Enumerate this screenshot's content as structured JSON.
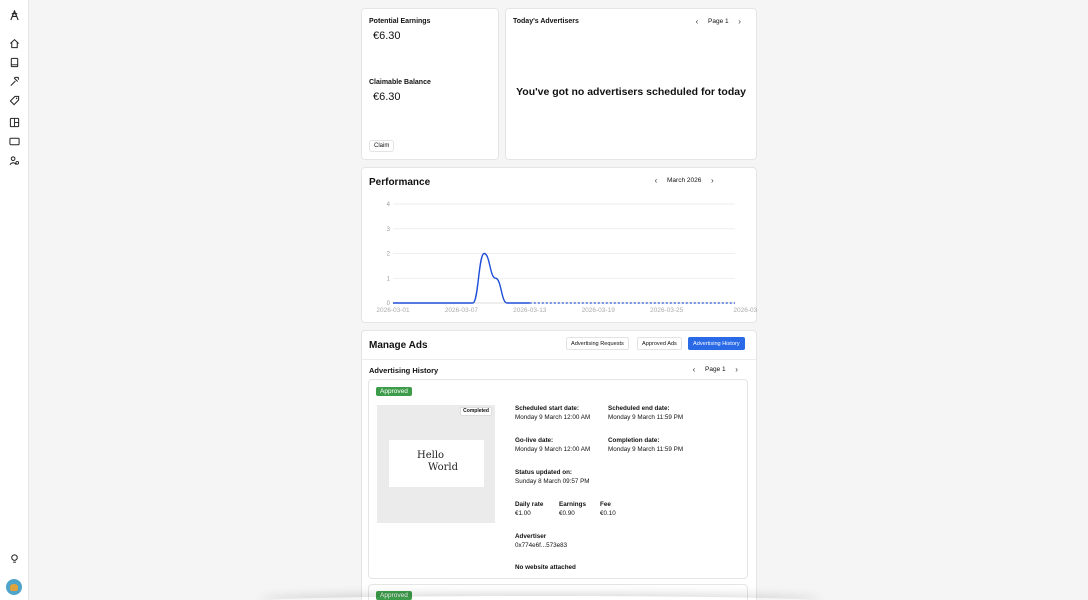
{
  "sidebar": {
    "items": [
      {
        "name": "logo-icon"
      },
      {
        "name": "home-icon"
      },
      {
        "name": "book-icon"
      },
      {
        "name": "hammer-icon"
      },
      {
        "name": "tag-icon"
      },
      {
        "name": "layout-icon"
      },
      {
        "name": "monitor-icon"
      },
      {
        "name": "users-icon"
      },
      {
        "name": "lightbulb-icon"
      }
    ]
  },
  "earnings": {
    "potential_label": "Potential Earnings",
    "potential_value": "€6.30",
    "claimable_label": "Claimable Balance",
    "claimable_value": "€6.30",
    "claim_button": "Claim"
  },
  "advertisers": {
    "title": "Today's Advertisers",
    "page": "Page 1",
    "empty_message": "You've got no advertisers scheduled for today"
  },
  "performance": {
    "title": "Performance",
    "month": "March 2026"
  },
  "chart_data": {
    "type": "line",
    "x": [
      "2026-03-01",
      "2026-03-02",
      "2026-03-03",
      "2026-03-04",
      "2026-03-05",
      "2026-03-06",
      "2026-03-07",
      "2026-03-08",
      "2026-03-09",
      "2026-03-10",
      "2026-03-11",
      "2026-03-12",
      "2026-03-13",
      "2026-03-14",
      "2026-03-15",
      "2026-03-16",
      "2026-03-17",
      "2026-03-18",
      "2026-03-19",
      "2026-03-20",
      "2026-03-21",
      "2026-03-22",
      "2026-03-23",
      "2026-03-24",
      "2026-03-25",
      "2026-03-26",
      "2026-03-27",
      "2026-03-28",
      "2026-03-29",
      "2026-03-30",
      "2026-03-31"
    ],
    "series": [
      {
        "values": [
          0,
          0,
          0,
          0,
          0,
          0,
          0,
          0,
          2,
          1,
          0,
          0,
          0,
          0,
          0,
          0,
          0,
          0,
          0,
          0,
          0,
          0,
          0,
          0,
          0,
          0,
          0,
          0,
          0,
          0,
          0
        ],
        "solid_until_index": 12,
        "color": "#1f4fd8"
      }
    ],
    "x_ticks": [
      "2026-03-01",
      "2026-03-07",
      "2026-03-13",
      "2026-03-19",
      "2026-03-25",
      "2026-03-"
    ],
    "y_ticks": [
      0,
      1,
      2,
      3,
      4
    ],
    "ylim": [
      0,
      4
    ],
    "grid": true,
    "title": "",
    "xlabel": "",
    "ylabel": ""
  },
  "manage": {
    "title": "Manage Ads",
    "tabs": [
      "Advertising Requests",
      "Approved Ads",
      "Advertising History"
    ],
    "active_tab": "Advertising History",
    "history_title": "Advertising History",
    "page": "Page 1"
  },
  "ad": {
    "status": "Approved",
    "preview_tag": "Completed",
    "preview_text_line1": "Hello",
    "preview_text_line2": "World",
    "sched_start_label": "Scheduled start date:",
    "sched_start_value": "Monday 9 March 12:00 AM",
    "sched_end_label": "Scheduled end date:",
    "sched_end_value": "Monday 9 March 11:59 PM",
    "golive_label": "Go-live date:",
    "golive_value": "Monday 9 March 12:00 AM",
    "completion_label": "Completion date:",
    "completion_value": "Monday 9 March 11:59 PM",
    "status_updated_label": "Status updated on:",
    "status_updated_value": "Sunday 8 March 09:57 PM",
    "daily_rate_label": "Daily rate",
    "daily_rate_value": "€1.00",
    "earnings_label": "Earnings",
    "earnings_value": "€0.90",
    "fee_label": "Fee",
    "fee_value": "€0.10",
    "advertiser_label": "Advertiser",
    "advertiser_value": "0x774e6f...573e83",
    "website_note": "No website attached"
  },
  "ad2": {
    "status": "Approved"
  },
  "colors": {
    "accent": "#2a6ae6",
    "approved": "#3d9c49",
    "line": "#1f4fd8"
  }
}
